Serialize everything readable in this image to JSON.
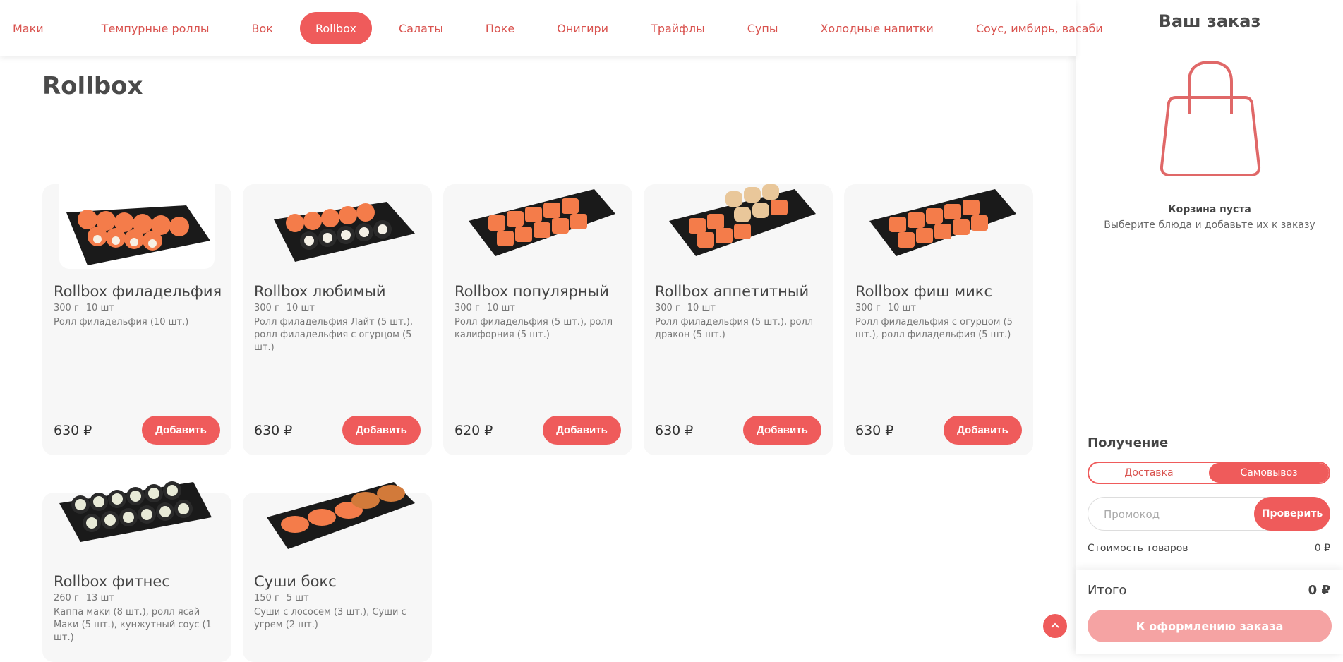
{
  "nav": {
    "items": [
      "Маки",
      "Темпурные роллы",
      "Вок",
      "Rollbox",
      "Салаты",
      "Поке",
      "Онигири",
      "Трайфлы",
      "Супы",
      "Холодные напитки",
      "Соус, имбирь, васаби"
    ],
    "active": "Rollbox"
  },
  "page": {
    "title": "Rollbox"
  },
  "products": [
    {
      "name": "Rollbox филадельфия",
      "weight": "300 г",
      "count": "10 шт",
      "desc": "Ролл филадельфия (10 шт.)",
      "price": "630 ₽",
      "add": "Добавить"
    },
    {
      "name": "Rollbox любимый",
      "weight": "300 г",
      "count": "10 шт",
      "desc": "Ролл филадельфия Лайт (5 шт.), ролл филадельфия с огурцом (5 шт.)",
      "price": "630 ₽",
      "add": "Добавить"
    },
    {
      "name": "Rollbox популярный",
      "weight": "300 г",
      "count": "10 шт",
      "desc": "Ролл филадельфия (5 шт.), ролл калифорния (5 шт.)",
      "price": "620 ₽",
      "add": "Добавить"
    },
    {
      "name": "Rollbox аппетитный",
      "weight": "300 г",
      "count": "10 шт",
      "desc": "Ролл филадельфия (5 шт.), ролл дракон (5 шт.)",
      "price": "630 ₽",
      "add": "Добавить"
    },
    {
      "name": "Rollbox фиш микс",
      "weight": "300 г",
      "count": "10 шт",
      "desc": "Ролл филадельфия с огурцом (5 шт.), ролл филадельфия (5 шт.)",
      "price": "630 ₽",
      "add": "Добавить"
    },
    {
      "name": "Rollbox фитнес",
      "weight": "260 г",
      "count": "13 шт",
      "desc": "Каппа маки (8 шт.), ролл ясай Маки (5 шт.), кунжутный соус (1 шт.)"
    },
    {
      "name": "Суши бокс",
      "weight": "150 г",
      "count": "5 шт",
      "desc": "Суши с лососем (3 шт.), Суши с угрем (2 шт.)"
    }
  ],
  "cart": {
    "title": "Ваш заказ",
    "empty_title": "Корзина пуста",
    "empty_sub": "Выберите блюда и добавьте их к заказу",
    "receive_label": "Получение",
    "delivery": "Доставка",
    "pickup": "Самовывоз",
    "promo_placeholder": "Промокод",
    "promo_button": "Проверить",
    "cost_label": "Стоимость товаров",
    "cost_value": "0 ₽",
    "total_label": "Итого",
    "total_value": "0 ₽",
    "checkout": "К оформлению заказа"
  },
  "colors": {
    "accent": "#ef5b5b",
    "accent_light": "#f5a3a3",
    "card_bg": "#f7f7f7"
  }
}
